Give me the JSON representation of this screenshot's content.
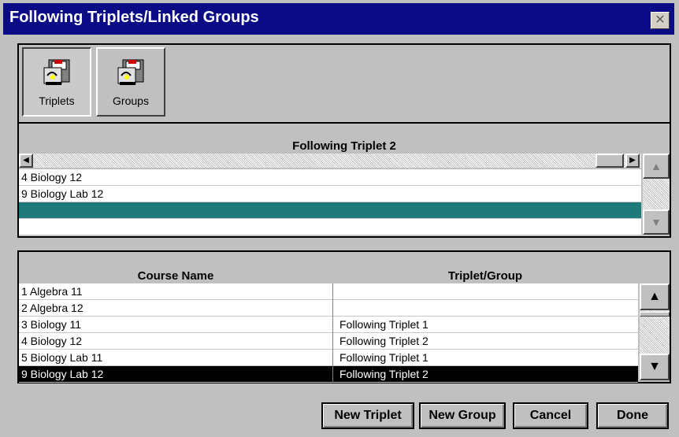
{
  "window": {
    "title": "Following Triplets/Linked Groups",
    "close_label": "✕"
  },
  "toolbar": {
    "triplets_label": "Triplets",
    "groups_label": "Groups"
  },
  "list": {
    "header": "Following Triplet 2",
    "items": [
      "4 Biology 12",
      "9 Biology Lab 12",
      "",
      ""
    ]
  },
  "table": {
    "columns": [
      "Course Name",
      "Triplet/Group"
    ],
    "rows": [
      [
        "1 Algebra 11",
        ""
      ],
      [
        "2 Algebra 12",
        ""
      ],
      [
        "3 Biology 11",
        "Following Triplet 1"
      ],
      [
        "4 Biology 12",
        "Following Triplet 2"
      ],
      [
        "5 Biology Lab 11",
        "Following Triplet 1"
      ],
      [
        "9 Biology Lab 12",
        "Following Triplet 2"
      ]
    ],
    "selected_row": 5
  },
  "buttons": {
    "new_triplet": "New Triplet",
    "new_group": "New Group",
    "cancel": "Cancel",
    "done": "Done"
  },
  "colors": {
    "titlebar": "#0b0b86",
    "highlight_teal": "#1f7a7a",
    "selected_row": "#000000"
  },
  "icons": {
    "triplets": "cabinet-drawer-icon",
    "groups": "cabinet-drawer-icon"
  }
}
